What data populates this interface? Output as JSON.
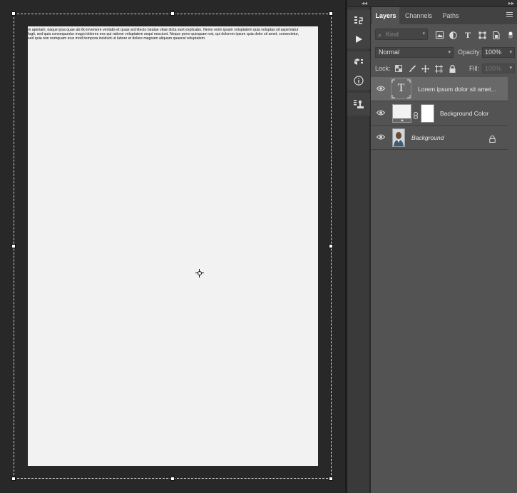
{
  "canvas": {
    "document_text_lines": [
      "m aperiam, eaque ipsa quae ab illo inventore veritatis et quasi architecto beatae vitae dicta sunt explicabo. Nemo enim ipsam voluptatem quia voluptas sit aspernatur",
      "fugit, sed quia consequuntur magni dolores eos qui ratione voluptatem sequi nesciunt. Neque porro quisquam est, qui dolorem ipsum quia dolor sit amet, consectetur,",
      "sed quia non numquam eius modi tempora incidunt ut labore et dolore magnam aliquam quaerat voluptatem."
    ]
  },
  "toolbar_top": {
    "collapse_left": "◂◂",
    "collapse_right": "▸▸"
  },
  "layers_panel": {
    "tabs": [
      {
        "label": "Layers",
        "active": true
      },
      {
        "label": "Channels",
        "active": false
      },
      {
        "label": "Paths",
        "active": false
      }
    ],
    "filter": {
      "placeholder": "Kind",
      "icons": [
        "image-filter-icon",
        "adjustment-filter-icon",
        "type-filter-icon",
        "shape-filter-icon",
        "smart-object-filter-icon"
      ]
    },
    "blend_mode": "Normal",
    "opacity_label": "Opacity:",
    "opacity_value": "100%",
    "lock_label": "Lock:",
    "fill_label": "Fill:",
    "fill_value": "100%",
    "layers": [
      {
        "name": "Lorem ipsum dolor sit amet...",
        "type": "text",
        "selected": true,
        "visible": true,
        "thumb_glyph": "T"
      },
      {
        "name": "Background Color",
        "type": "fill",
        "selected": false,
        "visible": true
      },
      {
        "name": "Background",
        "type": "image",
        "selected": false,
        "visible": true,
        "locked": true
      }
    ]
  },
  "colors": {
    "workspace_bg": "#282828",
    "document_bg": "#f2f2f2",
    "panel_bg": "#535353",
    "selected_layer_bg": "#696969"
  }
}
